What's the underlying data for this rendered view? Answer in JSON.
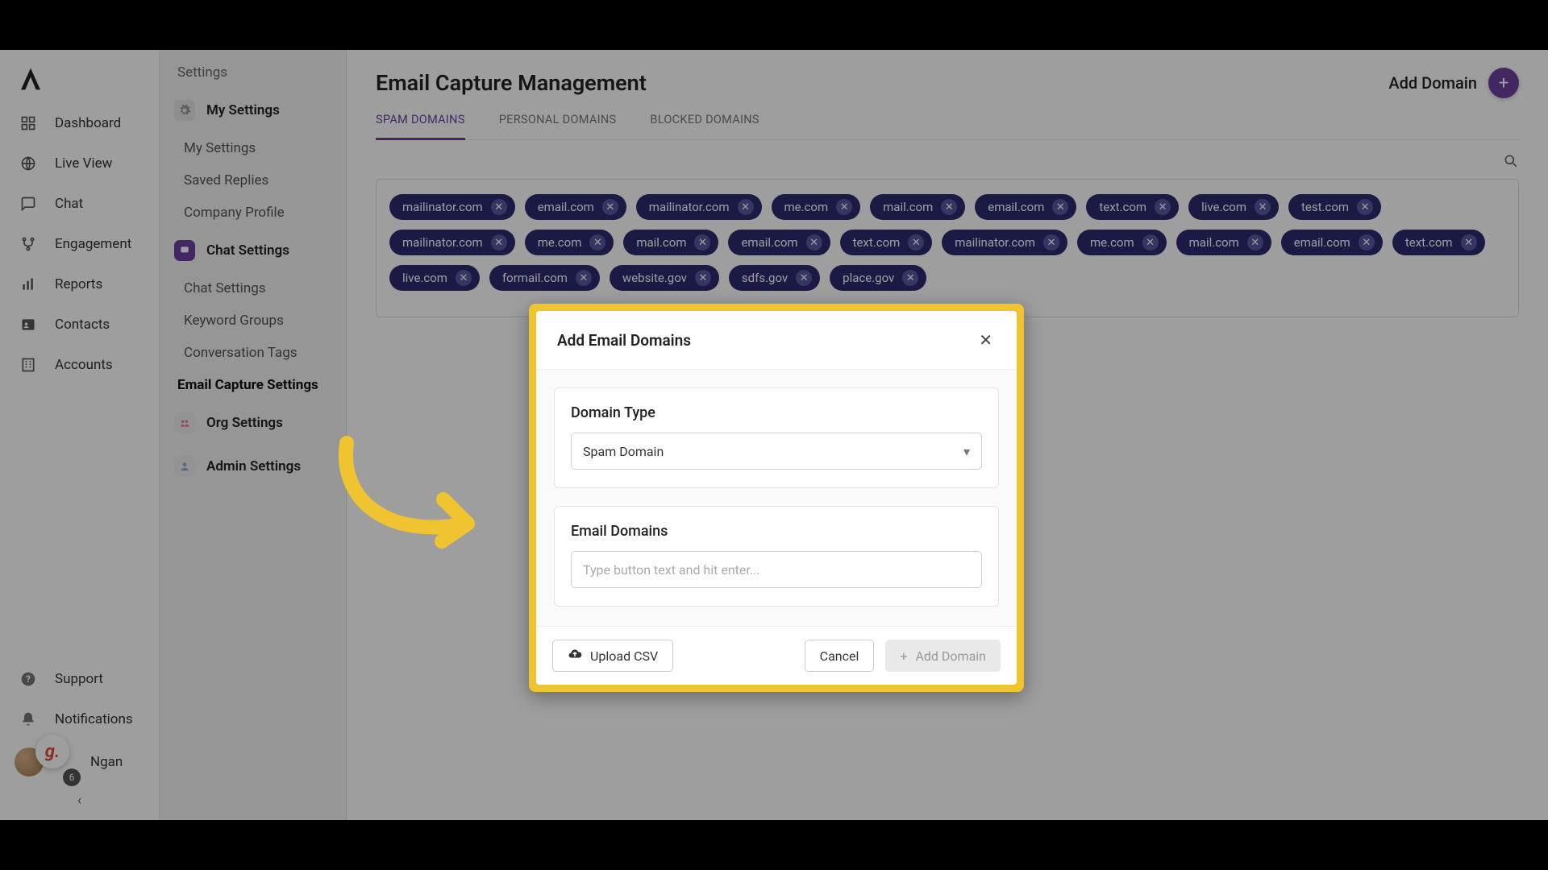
{
  "nav": {
    "items": [
      {
        "label": "Dashboard"
      },
      {
        "label": "Live View"
      },
      {
        "label": "Chat"
      },
      {
        "label": "Engagement"
      },
      {
        "label": "Reports"
      },
      {
        "label": "Contacts"
      },
      {
        "label": "Accounts"
      }
    ],
    "support": "Support",
    "notifications": "Notifications",
    "user_name": "Ngan",
    "g_badge": "g.",
    "count": "6"
  },
  "settings": {
    "heading": "Settings",
    "my": {
      "title": "My Settings",
      "items": [
        "My Settings",
        "Saved Replies",
        "Company Profile"
      ]
    },
    "chat": {
      "title": "Chat Settings",
      "items": [
        "Chat Settings",
        "Keyword Groups",
        "Conversation Tags",
        "Email Capture Settings"
      ],
      "active_index": 3
    },
    "org": {
      "title": "Org Settings"
    },
    "admin": {
      "title": "Admin Settings"
    }
  },
  "main": {
    "title": "Email Capture Management",
    "add_label": "Add Domain",
    "tabs": [
      "SPAM DOMAINS",
      "PERSONAL DOMAINS",
      "BLOCKED DOMAINS"
    ],
    "active_tab": 0,
    "chips": [
      "mailinator.com",
      "email.com",
      "mailinator.com",
      "me.com",
      "mail.com",
      "email.com",
      "text.com",
      "live.com",
      "test.com",
      "mailinator.com",
      "me.com",
      "mail.com",
      "email.com",
      "text.com",
      "mailinator.com",
      "me.com",
      "mail.com",
      "email.com",
      "text.com",
      "live.com",
      "formail.com",
      "website.gov",
      "sdfs.gov",
      "place.gov"
    ]
  },
  "modal": {
    "title": "Add Email Domains",
    "domain_type_label": "Domain Type",
    "domain_type_value": "Spam Domain",
    "email_domains_label": "Email Domains",
    "email_domains_placeholder": "Type button text and hit enter...",
    "upload_csv": "Upload CSV",
    "cancel": "Cancel",
    "add_domain": "Add Domain"
  }
}
